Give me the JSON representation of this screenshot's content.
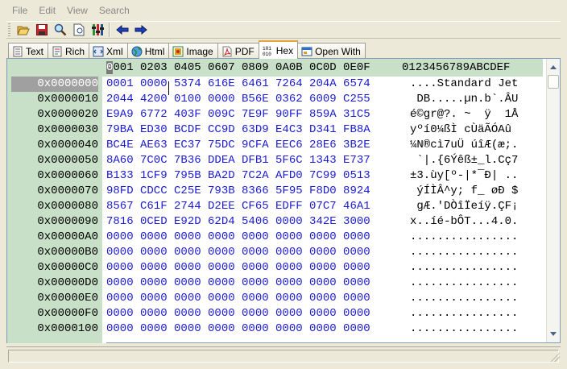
{
  "menu": [
    "File",
    "Edit",
    "View",
    "Search"
  ],
  "tabs": [
    {
      "label": "Text",
      "icon": "text-doc-icon"
    },
    {
      "label": "Rich",
      "icon": "rich-text-icon"
    },
    {
      "label": "Xml",
      "icon": "xml-icon"
    },
    {
      "label": "Html",
      "icon": "globe-icon"
    },
    {
      "label": "Image",
      "icon": "image-icon"
    },
    {
      "label": "PDF",
      "icon": "pdf-icon"
    },
    {
      "label": "Hex",
      "icon": "hex-binary-icon"
    },
    {
      "label": "Open With",
      "icon": "open-with-icon"
    }
  ],
  "active_tab": "Hex",
  "header": {
    "hex_cursor": "0",
    "hex_rest": "001 0203 0405 0607 0809 0A0B 0C0D 0E0F",
    "ascii": "0123456789ABCDEF"
  },
  "rows": [
    {
      "addr": "0x0000000",
      "hex": "0001 0000 5374 616E 6461 7264 204A 6574",
      "asc": "....Standard Jet"
    },
    {
      "addr": "0x0000010",
      "hex": "2044 4200 0100 0000 B56E 0362 6009 C255",
      "asc": " DB.....µn.b`.ÂU"
    },
    {
      "addr": "0x0000020",
      "hex": "E9A9 6772 403F 009C 7E9F 90FF 859A 31C5",
      "asc": "é©gr@?. ~  ÿ  1Å"
    },
    {
      "addr": "0x0000030",
      "hex": "79BA ED30 BCDF CC9D 63D9 E4C3 D341 FB8A",
      "asc": "yºí0¼ßÌ cÙäÃÓAû "
    },
    {
      "addr": "0x0000040",
      "hex": "BC4E AE63 EC37 75DC 9CFA EEC6 28E6 3B2E",
      "asc": "¼N®cì7uÜ úîÆ(æ;."
    },
    {
      "addr": "0x0000050",
      "hex": "8A60 7C0C 7B36 DDEA DFB1 5F6C 1343 E737",
      "asc": " `|.{6Ýêß±_l.Cç7"
    },
    {
      "addr": "0x0000060",
      "hex": "B133 1CF9 795B BA2D 7C2A AFD0 7C99 0513",
      "asc": "±3.ùy[º-|*¯Ð| .."
    },
    {
      "addr": "0x0000070",
      "hex": "98FD CDCC C25E 793B 8366 5F95 F8D0 8924",
      "asc": " ýÍÌÂ^y; f_ øÐ $"
    },
    {
      "addr": "0x0000080",
      "hex": "8567 C61F 2744 D2EE CF65 EDFF 07C7 46A1",
      "asc": " gÆ.'DÒîÏeíÿ.ÇF¡"
    },
    {
      "addr": "0x0000090",
      "hex": "7816 0CED E92D 62D4 5406 0000 342E 3000",
      "asc": "x..íé-bÔT...4.0."
    },
    {
      "addr": "0x00000A0",
      "hex": "0000 0000 0000 0000 0000 0000 0000 0000",
      "asc": "................"
    },
    {
      "addr": "0x00000B0",
      "hex": "0000 0000 0000 0000 0000 0000 0000 0000",
      "asc": "................"
    },
    {
      "addr": "0x00000C0",
      "hex": "0000 0000 0000 0000 0000 0000 0000 0000",
      "asc": "................"
    },
    {
      "addr": "0x00000D0",
      "hex": "0000 0000 0000 0000 0000 0000 0000 0000",
      "asc": "................"
    },
    {
      "addr": "0x00000E0",
      "hex": "0000 0000 0000 0000 0000 0000 0000 0000",
      "asc": "................"
    },
    {
      "addr": "0x00000F0",
      "hex": "0000 0000 0000 0000 0000 0000 0000 0000",
      "asc": "................"
    },
    {
      "addr": "0x0000100",
      "hex": "0000 0000 0000 0000 0000 0000 0000 0000",
      "asc": "................"
    }
  ],
  "colors": {
    "hex_text": "#1b1bd0",
    "gutter_bg": "#c7e0c7",
    "selected_addr_bg": "#a0a0a0",
    "active_tab_accent": "#e6a43c"
  }
}
